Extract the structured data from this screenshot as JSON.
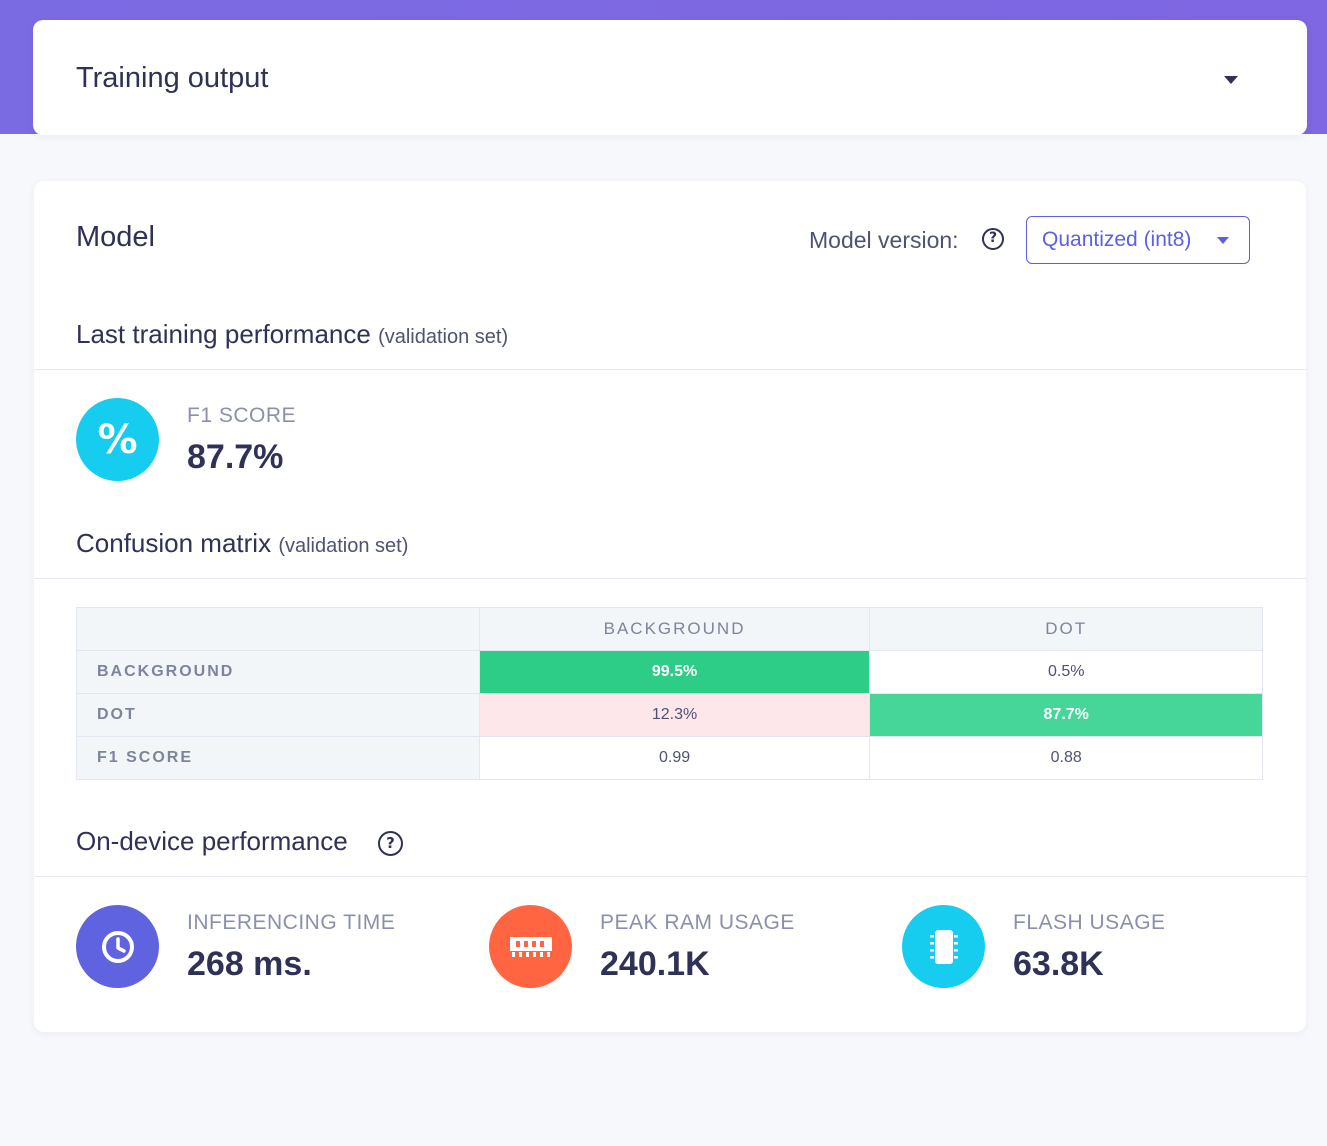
{
  "output_card": {
    "title": "Training output"
  },
  "model_card": {
    "title": "Model",
    "version_label": "Model version:",
    "version_selected": "Quantized (int8)"
  },
  "last_training": {
    "title": "Last training performance",
    "subtitle": "(validation set)",
    "f1_label": "F1 SCORE",
    "f1_value": "87.7%"
  },
  "confusion_matrix": {
    "title": "Confusion matrix",
    "subtitle": "(validation set)",
    "columns": [
      "BACKGROUND",
      "DOT"
    ],
    "rows": [
      {
        "label": "BACKGROUND",
        "cells": [
          "99.5%",
          "0.5%"
        ]
      },
      {
        "label": "DOT",
        "cells": [
          "12.3%",
          "87.7%"
        ]
      },
      {
        "label": "F1 SCORE",
        "cells": [
          "0.99",
          "0.88"
        ]
      }
    ]
  },
  "on_device": {
    "title": "On-device performance",
    "metrics": [
      {
        "label": "INFERENCING TIME",
        "value": "268 ms.",
        "icon": "clock-icon",
        "color": "#5f63e0"
      },
      {
        "label": "PEAK RAM USAGE",
        "value": "240.1K",
        "icon": "ram-icon",
        "color": "#ff6540"
      },
      {
        "label": "FLASH USAGE",
        "value": "63.8K",
        "icon": "chip-icon",
        "color": "#16cdef"
      }
    ]
  },
  "colors": {
    "accent": "#5b60e0",
    "f1_icon": "#16cdef",
    "cell_good_dark": "#2dcc87",
    "cell_good_light": "#47d699",
    "cell_bad": "#fde7ea"
  }
}
